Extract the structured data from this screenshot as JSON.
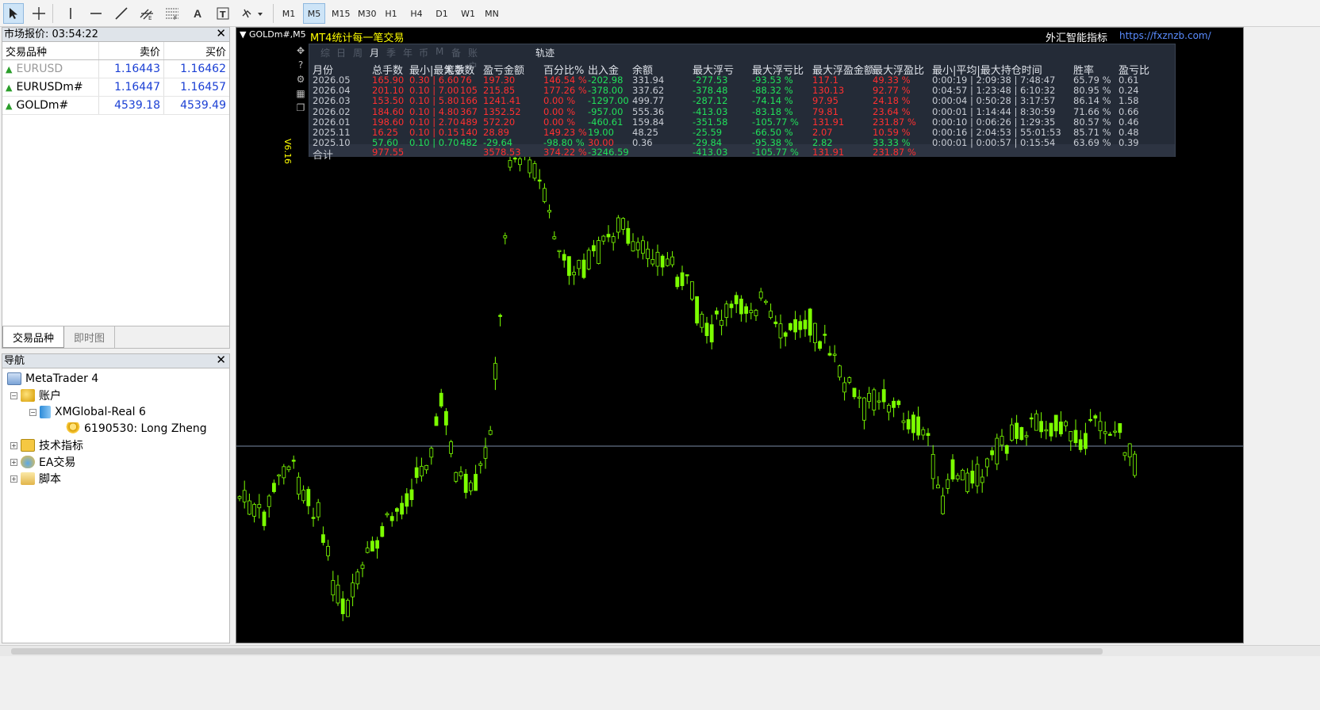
{
  "toolbar": {
    "tools": [
      "cursor-icon",
      "crosshair-icon",
      "vertical-line-icon",
      "horizontal-line-icon",
      "trendline-icon",
      "channel-icon",
      "fibonacci-icon",
      "text-icon",
      "label-icon",
      "shapes-icon"
    ],
    "timeframes": [
      "M1",
      "M5",
      "M15",
      "M30",
      "H1",
      "H4",
      "D1",
      "W1",
      "MN"
    ],
    "active_timeframe": "M5"
  },
  "market_watch": {
    "title": "市场报价: 03:54:22",
    "headers": {
      "symbol": "交易品种",
      "bid": "卖价",
      "ask": "买价"
    },
    "rows": [
      {
        "symbol": "EURUSD",
        "bid": "1.16443",
        "ask": "1.16462"
      },
      {
        "symbol": "EURUSDm#",
        "bid": "1.16447",
        "ask": "1.16457"
      },
      {
        "symbol": "GOLDm#",
        "bid": "4539.18",
        "ask": "4539.49"
      }
    ],
    "tabs": [
      "交易品种",
      "即时图"
    ]
  },
  "navigator": {
    "title": "导航",
    "root": "MetaTrader 4",
    "accounts": "账户",
    "server": "XMGlobal-Real 6",
    "account": "6190530: Long Zheng",
    "indicators": "技术指标",
    "experts": "EA交易",
    "scripts": "脚本"
  },
  "chart": {
    "title": "GOLDm#,M5",
    "ea_title": "MT4统计每一笔交易",
    "vendor": "外汇智能指标",
    "vendor_url": "https://fxznzb.com/",
    "version": "V6.16",
    "colors": {
      "bull": "#7cff00",
      "bear": "#000000",
      "bg": "#000000",
      "hline": "#7a8ca6"
    }
  },
  "stats": {
    "tabs": [
      "综",
      "日",
      "周",
      "月",
      "季",
      "年",
      "币",
      "M",
      "备",
      "账户"
    ],
    "active_tab": "月",
    "trajectory": "轨迹",
    "headers": [
      "月份",
      "总手数",
      "最小|最大手数",
      "笔数",
      "盈亏金额",
      "百分比%",
      "出入金",
      "余额",
      "最大浮亏",
      "最大浮亏比",
      "最大浮盈金额",
      "最大浮盈比",
      "最小|平均|最大持仓时间",
      "胜率",
      "盈亏比"
    ],
    "rows": [
      {
        "month": "2026.05",
        "lots": "165.90",
        "minmax": "0.30 | 6.60",
        "count": "76",
        "pnl": "197.30",
        "pct": "146.54 %",
        "flow": "-202.98",
        "balance": "331.94",
        "maxloss": "-277.53",
        "maxlosspct": "-93.53 %",
        "maxprofit": "117.1",
        "maxprofitpct": "49.33 %",
        "time": "0:00:19 | 2:09:38 | 7:48:47",
        "win": "65.79 %",
        "ratio": "0.61",
        "tone": "r"
      },
      {
        "month": "2026.04",
        "lots": "201.10",
        "minmax": "0.10 | 7.00",
        "count": "105",
        "pnl": "215.85",
        "pct": "177.26 %",
        "flow": "-378.00",
        "balance": "337.62",
        "maxloss": "-378.48",
        "maxlosspct": "-88.32 %",
        "maxprofit": "130.13",
        "maxprofitpct": "92.77 %",
        "time": "0:04:57 | 1:23:48 | 6:10:32",
        "win": "80.95 %",
        "ratio": "0.24",
        "tone": "r"
      },
      {
        "month": "2026.03",
        "lots": "153.50",
        "minmax": "0.10 | 5.80",
        "count": "166",
        "pnl": "1241.41",
        "pct": "0.00 %",
        "flow": "-1297.00",
        "balance": "499.77",
        "maxloss": "-287.12",
        "maxlosspct": "-74.14 %",
        "maxprofit": "97.95",
        "maxprofitpct": "24.18 %",
        "time": "0:00:04 | 0:50:28 | 3:17:57",
        "win": "86.14 %",
        "ratio": "1.58",
        "tone": "r"
      },
      {
        "month": "2026.02",
        "lots": "184.60",
        "minmax": "0.10 | 4.80",
        "count": "367",
        "pnl": "1352.52",
        "pct": "0.00 %",
        "flow": "-957.00",
        "balance": "555.36",
        "maxloss": "-413.03",
        "maxlosspct": "-83.18 %",
        "maxprofit": "79.81",
        "maxprofitpct": "23.64 %",
        "time": "0:00:01 | 1:14:44 | 8:30:59",
        "win": "71.66 %",
        "ratio": "0.66",
        "tone": "r"
      },
      {
        "month": "2026.01",
        "lots": "198.60",
        "minmax": "0.10 | 2.70",
        "count": "489",
        "pnl": "572.20",
        "pct": "0.00 %",
        "flow": "-460.61",
        "balance": "159.84",
        "maxloss": "-351.58",
        "maxlosspct": "-105.77 %",
        "maxprofit": "131.91",
        "maxprofitpct": "231.87 %",
        "time": "0:00:10 | 0:06:26 | 1:29:35",
        "win": "80.57 %",
        "ratio": "0.46",
        "tone": "r"
      },
      {
        "month": "2025.11",
        "lots": "16.25",
        "minmax": "0.10 | 0.15",
        "count": "140",
        "pnl": "28.89",
        "pct": "149.23 %",
        "flow": "19.00",
        "balance": "48.25",
        "maxloss": "-25.59",
        "maxlosspct": "-66.50 %",
        "maxprofit": "2.07",
        "maxprofitpct": "10.59 %",
        "time": "0:00:16 | 2:04:53 | 55:01:53",
        "win": "85.71 %",
        "ratio": "0.48",
        "tone": "r"
      },
      {
        "month": "2025.10",
        "lots": "57.60",
        "minmax": "0.10 | 0.70",
        "count": "482",
        "pnl": "-29.64",
        "pct": "-98.80 %",
        "flow": "30.00",
        "balance": "0.36",
        "maxloss": "-29.84",
        "maxlosspct": "-95.38 %",
        "maxprofit": "2.82",
        "maxprofitpct": "33.33 %",
        "time": "0:00:01 | 0:00:57 | 0:15:54",
        "win": "63.69 %",
        "ratio": "0.39",
        "tone": "g"
      }
    ],
    "total": {
      "label": "合计",
      "lots": "977.55",
      "pnl": "3578.53",
      "pct": "374.22 %",
      "flow": "-3246.59",
      "maxloss": "-413.03",
      "maxlosspct": "-105.77 %",
      "maxprofit": "131.91",
      "maxprofitpct": "231.87 %"
    }
  }
}
